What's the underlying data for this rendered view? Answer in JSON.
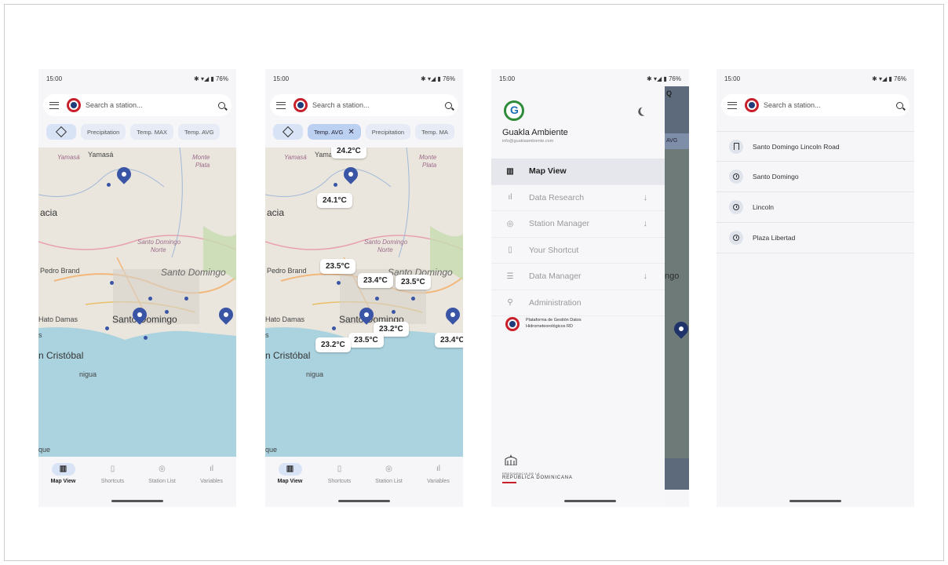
{
  "status": {
    "time": "15:00",
    "battery": "76%",
    "icons": "✱ ▾◢ ▮"
  },
  "search": {
    "placeholder": "Search a station..."
  },
  "chips": {
    "precipitation": "Precipitation",
    "temp_max": "Temp. MAX",
    "temp_avg": "Temp. AVG",
    "temp_max_short": "Temp. MA"
  },
  "map": {
    "labels": {
      "yamasa": "Yamasá",
      "yamasa_italic": "Yamasá",
      "monte": "Monte",
      "plata": "Plata",
      "acia": "acia",
      "sd_norte_1": "Santo Domingo",
      "sd_norte_2": "Norte",
      "pedro_brand": "Pedro Brand",
      "sd_east": "Santo Domingo",
      "sd_city": "Santo Domingo",
      "hato_damas": "Hato Damas",
      "s_left": "s",
      "cristobal": "n Cristóbal",
      "nigua": "nigua",
      "que": "que"
    },
    "temps": [
      "24.2°C",
      "24.1°C",
      "23.5°C",
      "23.4°C",
      "23.5°C",
      "23.2°C",
      "23.5°C",
      "23.2°C",
      "23.4°C"
    ]
  },
  "nav": {
    "map_view": "Map View",
    "shortcuts": "Shortcuts",
    "station_list": "Station List",
    "variables": "Variables"
  },
  "drawer": {
    "name": "Guakla Ambiente",
    "email": "info@guaklaambiente.com",
    "items": [
      {
        "label": "Map View"
      },
      {
        "label": "Data Research"
      },
      {
        "label": "Station Manager"
      },
      {
        "label": "Your Shortcut"
      },
      {
        "label": "Data Manager"
      },
      {
        "label": "Administration"
      }
    ],
    "platform": "Plataforma de Gestión Datos Hidrometeorológicos RD",
    "gov_top": "PRESIDENCIA DE LA",
    "gov_name": "REPÚBLICA DOMINICANA"
  },
  "scrim": {
    "chip": "AVG",
    "label": "ngo"
  },
  "stations": [
    {
      "name": "Santo Domingo Lincoln Road",
      "icon": "bookmark-icon"
    },
    {
      "name": "Santo Domingo",
      "icon": "clock-icon"
    },
    {
      "name": "Lincoln",
      "icon": "clock-icon"
    },
    {
      "name": "Plaza Libertad",
      "icon": "clock-icon"
    }
  ]
}
